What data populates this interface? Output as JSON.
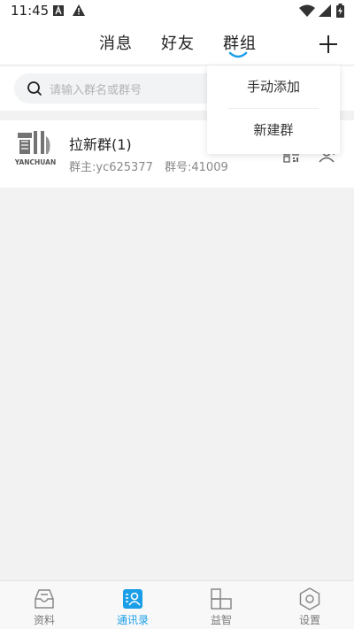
{
  "status_bar": {
    "time": "11:45"
  },
  "header": {
    "tabs": [
      {
        "label": "消息"
      },
      {
        "label": "好友"
      },
      {
        "label": "群组"
      }
    ],
    "active_tab": "群组",
    "accent_color": "#1a9ee8"
  },
  "search": {
    "placeholder": "请输入群名或群号"
  },
  "dropdown": {
    "items": [
      {
        "label": "手动添加"
      },
      {
        "label": "新建群"
      }
    ]
  },
  "groups": [
    {
      "name": "拉新群(1)",
      "owner": "群主:yc625377",
      "number": "群号:41009",
      "avatar_text": "YANCHUAN"
    }
  ],
  "bottom_nav": {
    "items": [
      {
        "label": "资料",
        "icon": "inbox-icon",
        "active": false
      },
      {
        "label": "通讯录",
        "icon": "contacts-icon",
        "active": true
      },
      {
        "label": "益智",
        "icon": "blocks-icon",
        "active": false
      },
      {
        "label": "设置",
        "icon": "hexagon-settings-icon",
        "active": false
      }
    ]
  }
}
